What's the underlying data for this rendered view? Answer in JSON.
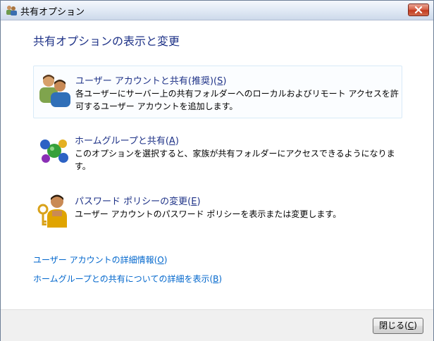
{
  "window": {
    "title": "共有オプション"
  },
  "main": {
    "heading": "共有オプションの表示と変更",
    "options": [
      {
        "title_prefix": "ユーザー アカウントと共有(推奨)(",
        "accel": "S",
        "title_suffix": ")",
        "description": "各ユーザーにサーバー上の共有フォルダーへのローカルおよびリモート アクセスを許可するユーザー アカウントを追加します。",
        "icon": "users-icon"
      },
      {
        "title_prefix": "ホームグループと共有(",
        "accel": "A",
        "title_suffix": ")",
        "description": "このオプションを選択すると、家族が共有フォルダーにアクセスできるようになります。",
        "icon": "homegroup-icon"
      },
      {
        "title_prefix": "パスワード ポリシーの変更(",
        "accel": "E",
        "title_suffix": ")",
        "description": "ユーザー アカウントのパスワード ポリシーを表示または変更します。",
        "icon": "password-policy-icon"
      }
    ],
    "links": [
      {
        "prefix": "ユーザー アカウントの詳細情報(",
        "accel": "O",
        "suffix": ")"
      },
      {
        "prefix": "ホームグループとの共有についての詳細を表示(",
        "accel": "B",
        "suffix": ")"
      }
    ]
  },
  "footer": {
    "close_prefix": "閉じる(",
    "close_accel": "C",
    "close_suffix": ")"
  }
}
